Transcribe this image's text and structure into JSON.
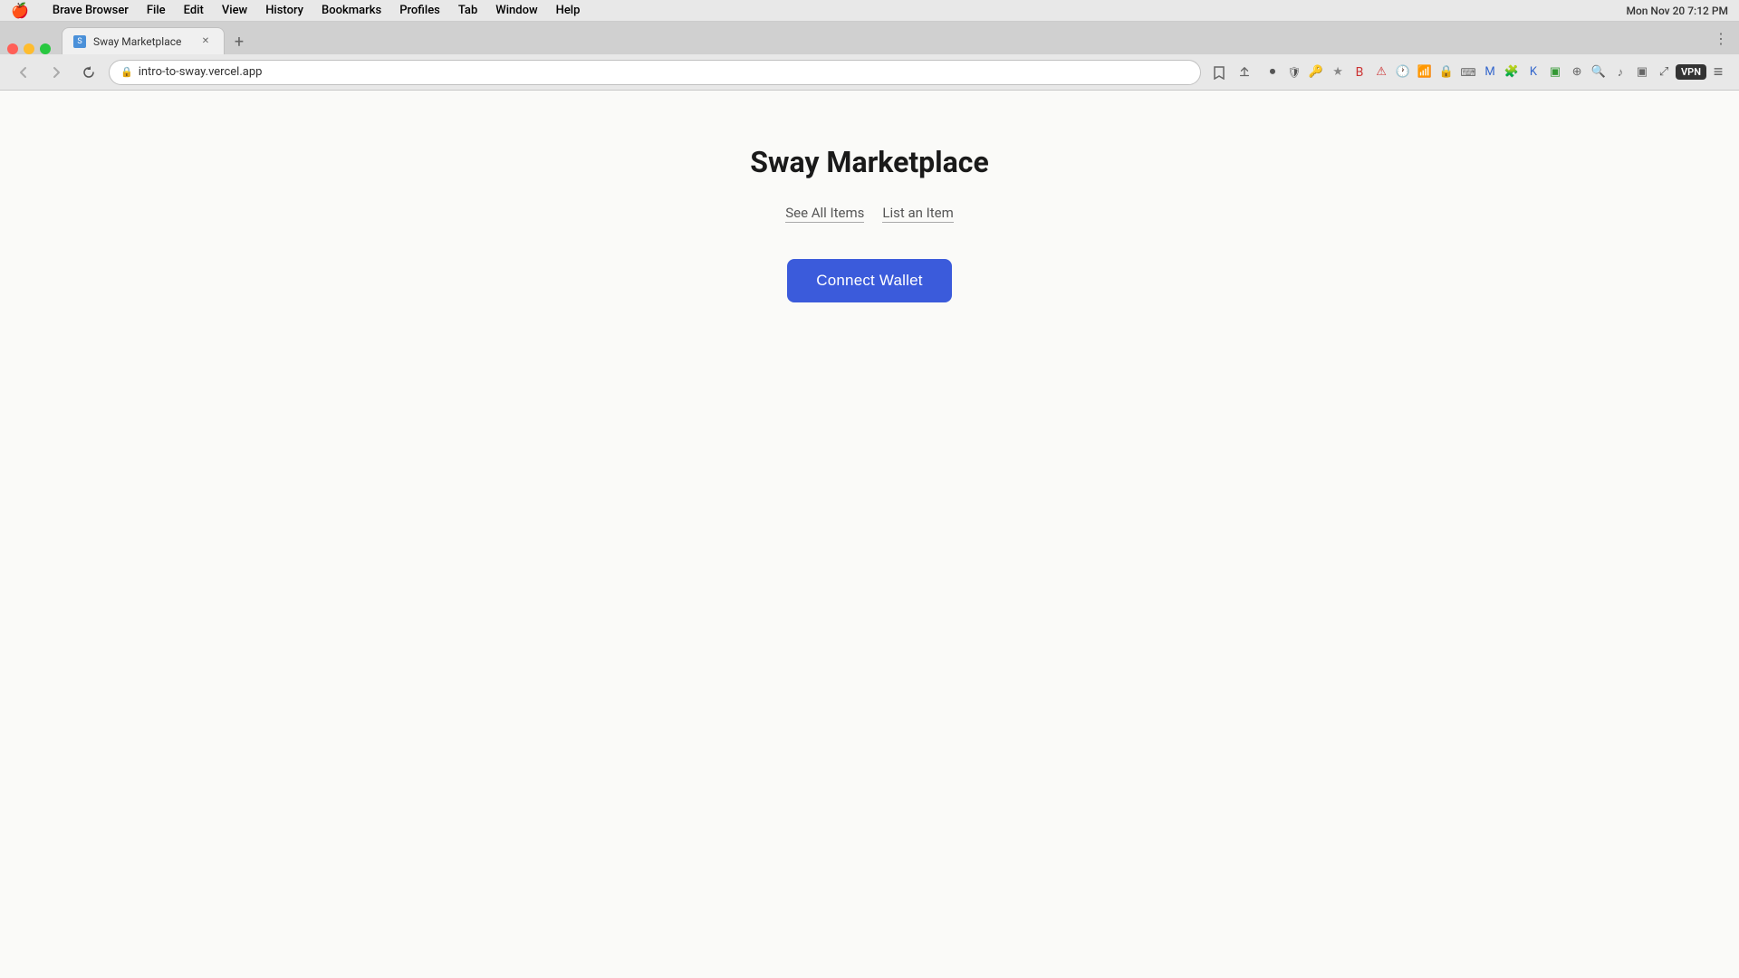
{
  "menubar": {
    "apple": "🍎",
    "items": [
      "Brave Browser",
      "File",
      "Edit",
      "View",
      "History",
      "Bookmarks",
      "Profiles",
      "Tab",
      "Window",
      "Help"
    ],
    "right": {
      "datetime": "Mon Nov 20  7:12 PM"
    }
  },
  "browser": {
    "tab": {
      "title": "Sway Marketplace",
      "favicon": "S",
      "url": "intro-to-sway.vercel.app"
    },
    "new_tab_label": "+",
    "expand_label": "⋮"
  },
  "page": {
    "title": "Sway Marketplace",
    "nav_links": [
      {
        "label": "See All Items",
        "id": "see-all-items"
      },
      {
        "label": "List an Item",
        "id": "list-an-item"
      }
    ],
    "connect_wallet_label": "Connect Wallet"
  }
}
